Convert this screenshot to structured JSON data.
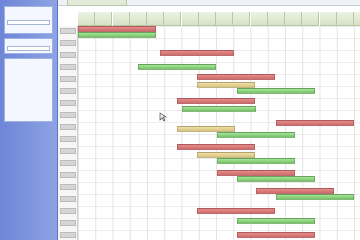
{
  "sidebar": {
    "panels": [
      {
        "rows": [
          "",
          "",
          ""
        ],
        "field": ""
      },
      {
        "rows": [
          ""
        ],
        "field": ""
      },
      {
        "rows": [
          "",
          "",
          "",
          "",
          "",
          "",
          "",
          "",
          "",
          "",
          "",
          "",
          ""
        ]
      }
    ]
  },
  "main": {
    "active_tab": ""
  },
  "gantt": {
    "column_headers": [
      "",
      "",
      "",
      "",
      "",
      "",
      "",
      "",
      "",
      "",
      "",
      "",
      "",
      "",
      "",
      "",
      ""
    ],
    "row_labels": [
      "",
      "",
      "",
      "",
      "",
      "",
      "",
      "",
      "",
      "",
      "",
      "",
      "",
      "",
      "",
      "",
      "",
      "",
      ""
    ],
    "bars": [
      {
        "color": "red",
        "label": ""
      },
      {
        "color": "green",
        "label": ""
      },
      {
        "color": "red",
        "label": ""
      },
      {
        "color": "green",
        "label": ""
      },
      {
        "color": "red",
        "label": ""
      },
      {
        "color": "tan",
        "label": ""
      },
      {
        "color": "green",
        "label": ""
      },
      {
        "color": "red",
        "label": ""
      },
      {
        "color": "green",
        "label": ""
      },
      {
        "color": "red",
        "label": ""
      },
      {
        "color": "tan",
        "label": ""
      },
      {
        "color": "green",
        "label": ""
      },
      {
        "color": "red",
        "label": ""
      },
      {
        "color": "tan",
        "label": ""
      },
      {
        "color": "green",
        "label": ""
      },
      {
        "color": "red",
        "label": ""
      },
      {
        "color": "green",
        "label": ""
      },
      {
        "color": "red",
        "label": ""
      },
      {
        "color": "green",
        "label": ""
      },
      {
        "color": "red",
        "label": ""
      },
      {
        "color": "green",
        "label": ""
      },
      {
        "color": "red",
        "label": ""
      }
    ]
  },
  "colors": {
    "sidebar": "#6d86d6",
    "bar_red": "#cf6a6a",
    "bar_green": "#73c468",
    "bar_tan": "#d9c27e",
    "header": "#d5e2c5"
  }
}
